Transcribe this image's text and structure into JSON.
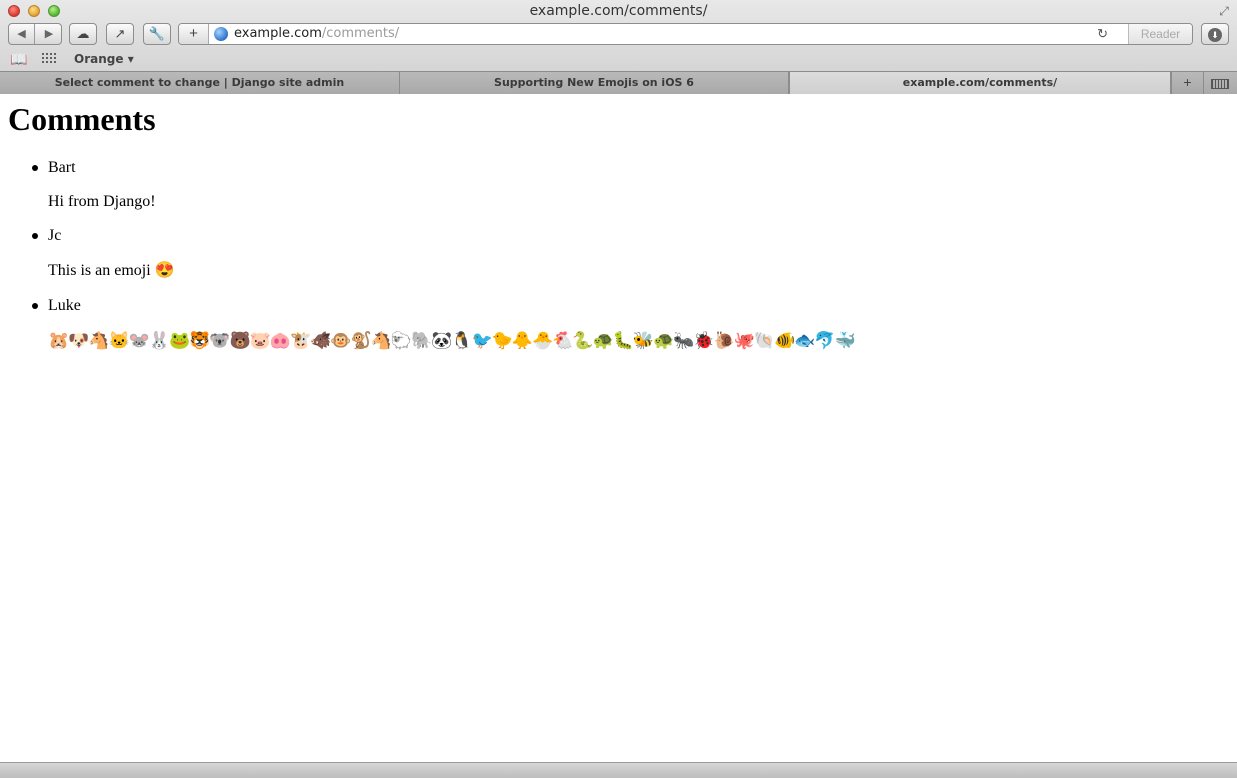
{
  "window": {
    "title": "example.com/comments/"
  },
  "toolbar": {
    "url_host": "example.com",
    "url_path": "/comments/",
    "reader_label": "Reader"
  },
  "bookmarks": {
    "folder_label": "Orange"
  },
  "tabs": [
    {
      "label": "Select comment to change | Django site admin"
    },
    {
      "label": "Supporting New Emojis on iOS 6"
    },
    {
      "label": "example.com/comments/"
    }
  ],
  "page": {
    "heading": "Comments",
    "comments": [
      {
        "author": "Bart",
        "body": "Hi from Django!"
      },
      {
        "author": "Jc",
        "body": "This is an emoji 😍"
      },
      {
        "author": "Luke",
        "body": "🐹🐶🐴🐱🐭🐰🐸🐯🐨🐻🐷🐽🐮🐗🐵🐒🐴🐑🐘🐼🐧🐦🐤🐥🐣🐔🐍🐢🐛🐝🐢🐜🐞🐌🐙🐚🐠🐟🐬🐳"
      }
    ]
  }
}
